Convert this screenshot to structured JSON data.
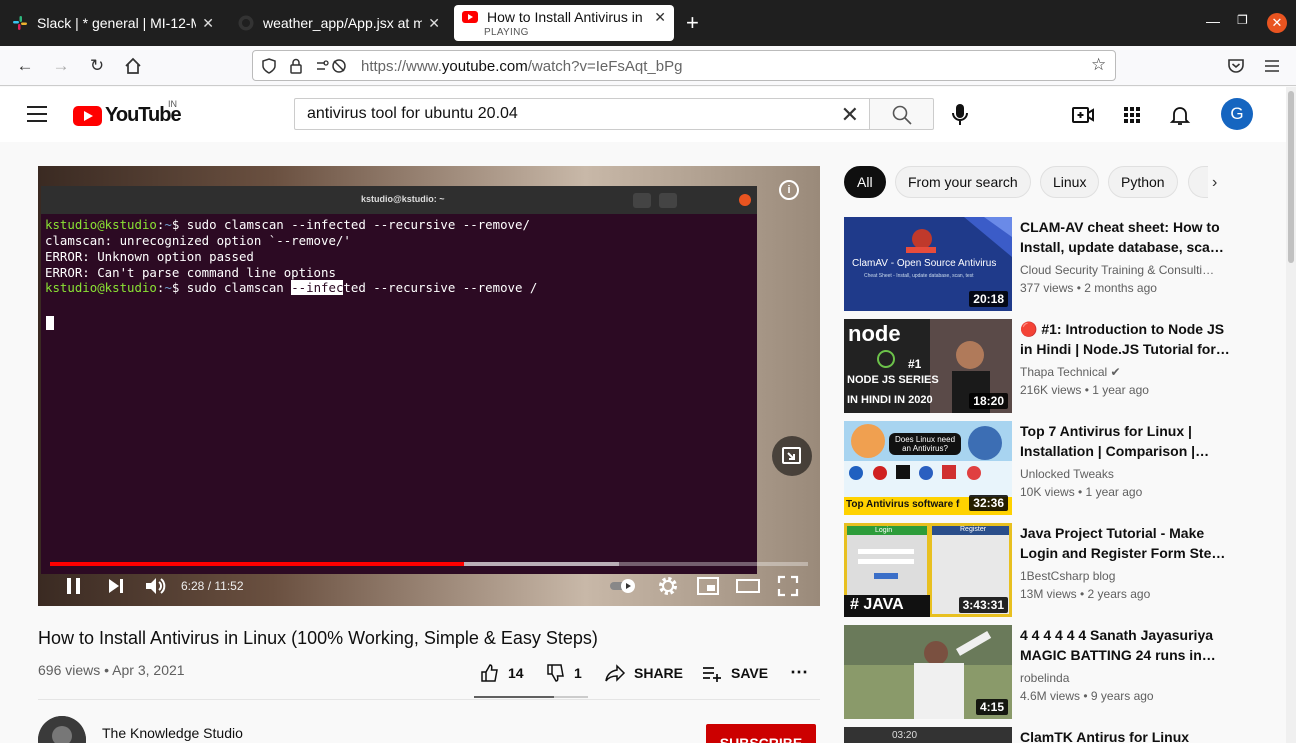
{
  "browser": {
    "tabs": [
      {
        "title": "Slack | * general | MI-12-M"
      },
      {
        "title": "weather_app/App.jsx at m"
      },
      {
        "title": "How to Install Antivirus in",
        "subtitle": "PLAYING"
      }
    ],
    "url_prefix": "https://www.",
    "url_domain": "youtube.com",
    "url_path": "/watch?v=IeFsAqt_bPg"
  },
  "youtube": {
    "logo": "YouTube",
    "country": "IN",
    "search_value": "antivirus tool for ubuntu 20.04",
    "avatar_letter": "G"
  },
  "player": {
    "terminal_title": "kstudio@kstudio: ~",
    "lines": [
      {
        "prompt": "kstudio@kstudio",
        "path": "~",
        "cmd": "$ sudo clamscan --infected --recursive --remove/"
      },
      {
        "text": "clamscan: unrecognized option `--remove/'"
      },
      {
        "text": "ERROR: Unknown option passed"
      },
      {
        "text": "ERROR: Can't parse command line options"
      },
      {
        "prompt": "kstudio@kstudio",
        "path": "~",
        "cmd_before": "$ sudo clamscan ",
        "cmd_sel": "--infec",
        "cmd_after": "ted --recursive --remove /"
      }
    ],
    "time": "6:28 / 11:52",
    "played_fraction": 0.546,
    "buffered_fraction": 0.75
  },
  "video": {
    "title": "How to Install Antivirus in Linux (100% Working, Simple & Easy Steps)",
    "meta": "696 views • Apr 3, 2021",
    "likes": "14",
    "dislikes": "1",
    "share": "SHARE",
    "save": "SAVE",
    "channel": "The Knowledge Studio",
    "subscribe": "SUBSCRIBE"
  },
  "chips": [
    "All",
    "From your search",
    "Linux",
    "Python"
  ],
  "recs": [
    {
      "title": "CLAM-AV cheat sheet: How to Install, update database, sca…",
      "channel": "Cloud Security Training & Consulti…",
      "views": "377 views • 2 months ago",
      "dur": "20:18",
      "thumb_title": "ClamAV - Open Source Antivirus",
      "thumb_sub": "Cheat Sheet - Install, update database, scan, test"
    },
    {
      "title": "🔴 #1: Introduction to Node JS in Hindi | Node.JS Tutorial for…",
      "channel": "Thapa Technical ✔",
      "views": "216K views • 1 year ago",
      "dur": "18:20",
      "thumb_a": "#1",
      "thumb_b": "NODE JS SERIES",
      "thumb_c": "IN HINDI IN 2020"
    },
    {
      "title": "Top 7 Antivirus for Linux | Installation | Comparison |…",
      "channel": "Unlocked Tweaks",
      "views": "10K views • 1 year ago",
      "dur": "32:36",
      "thumb_q": "Does Linux need an Antivirus?",
      "thumb_b": "Top Antivirus software f"
    },
    {
      "title": "Java Project Tutorial - Make Login and Register Form Ste…",
      "channel": "1BestCsharp blog",
      "views": "13M views • 2 years ago",
      "dur": "3:43:31",
      "thumb_a": "# JAVA",
      "thumb_l": "Login",
      "thumb_r": "Register"
    },
    {
      "title": "4 4 4 4 4 4 Sanath Jayasuriya MAGIC BATTING 24 runs in…",
      "channel": "robelinda",
      "views": "4.6M views • 9 years ago",
      "dur": "4:15"
    },
    {
      "title": "ClamTK Antirus for Linux",
      "thumb_time": "03:20"
    }
  ]
}
